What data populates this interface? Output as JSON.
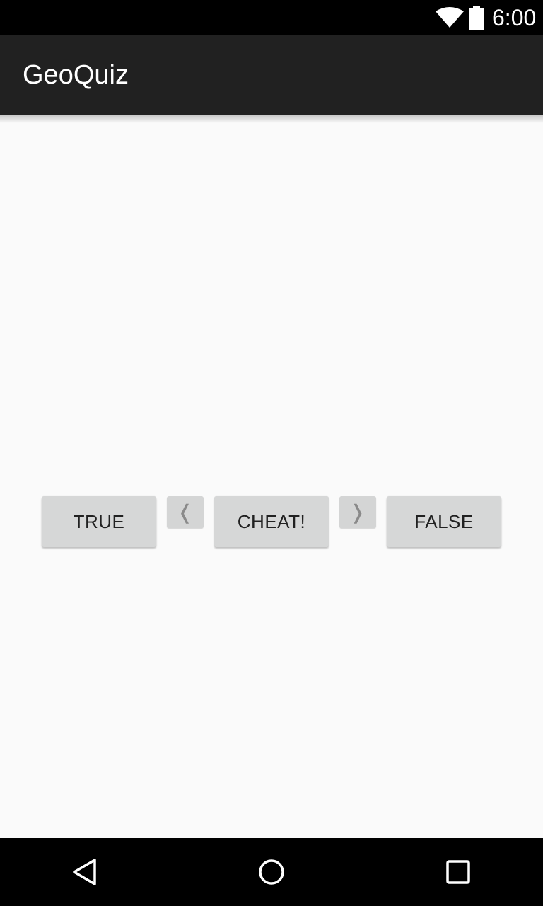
{
  "status_bar": {
    "time": "6:00",
    "wifi_icon": "wifi-icon",
    "battery_icon": "battery-icon"
  },
  "action_bar": {
    "title": "GeoQuiz"
  },
  "quiz": {
    "true_label": "TRUE",
    "prev_label": "❬",
    "cheat_label": "CHEAT!",
    "next_label": "❭",
    "false_label": "FALSE"
  },
  "nav_bar": {
    "back_icon": "back-triangle-icon",
    "home_icon": "home-circle-icon",
    "recents_icon": "recents-square-icon"
  },
  "colors": {
    "status_bar_bg": "#000000",
    "action_bar_bg": "#212121",
    "content_bg": "#fafafa",
    "button_bg": "#d6d7d7",
    "button_text": "#212121"
  }
}
